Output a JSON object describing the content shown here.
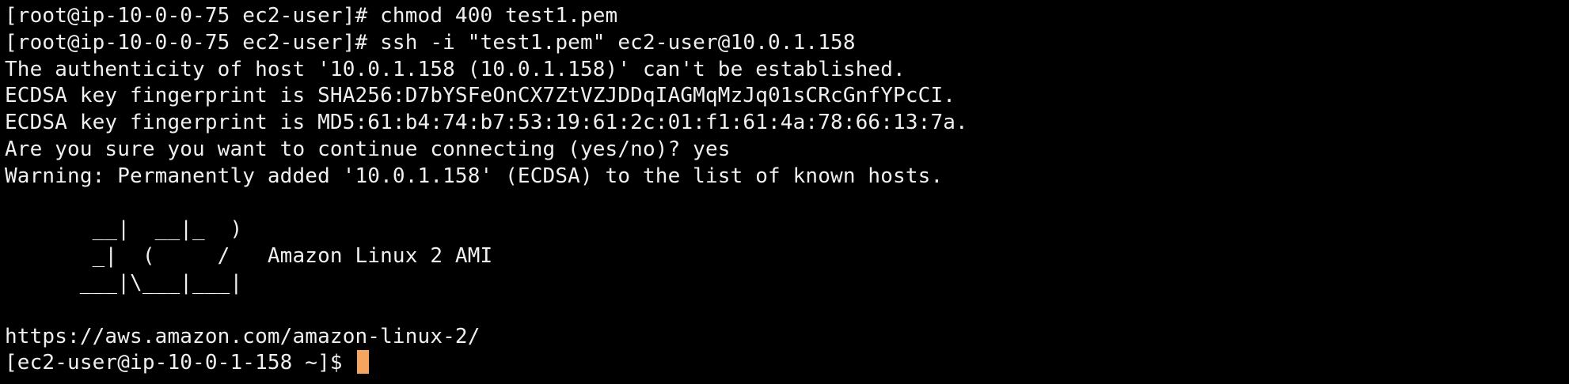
{
  "terminal": {
    "lines": [
      "[root@ip-10-0-0-75 ec2-user]# chmod 400 test1.pem",
      "[root@ip-10-0-0-75 ec2-user]# ssh -i \"test1.pem\" ec2-user@10.0.1.158",
      "The authenticity of host '10.0.1.158 (10.0.1.158)' can't be established.",
      "ECDSA key fingerprint is SHA256:D7bYSFeOnCX7ZtVZJDDqIAGMqMzJq01sCRcGnfYPcCI.",
      "ECDSA key fingerprint is MD5:61:b4:74:b7:53:19:61:2c:01:f1:61:4a:78:66:13:7a.",
      "Are you sure you want to continue connecting (yes/no)? yes",
      "Warning: Permanently added '10.0.1.158' (ECDSA) to the list of known hosts.",
      "",
      "       __|  __|_  )",
      "       _|  (     /   Amazon Linux 2 AMI",
      "      ___|\\___|___|",
      "",
      "https://aws.amazon.com/amazon-linux-2/"
    ],
    "prompt": "[ec2-user@ip-10-0-1-158 ~]$ ",
    "cursor_color": "#f5a560",
    "background_color": "#000000",
    "text_color": "#f0f0f0"
  }
}
